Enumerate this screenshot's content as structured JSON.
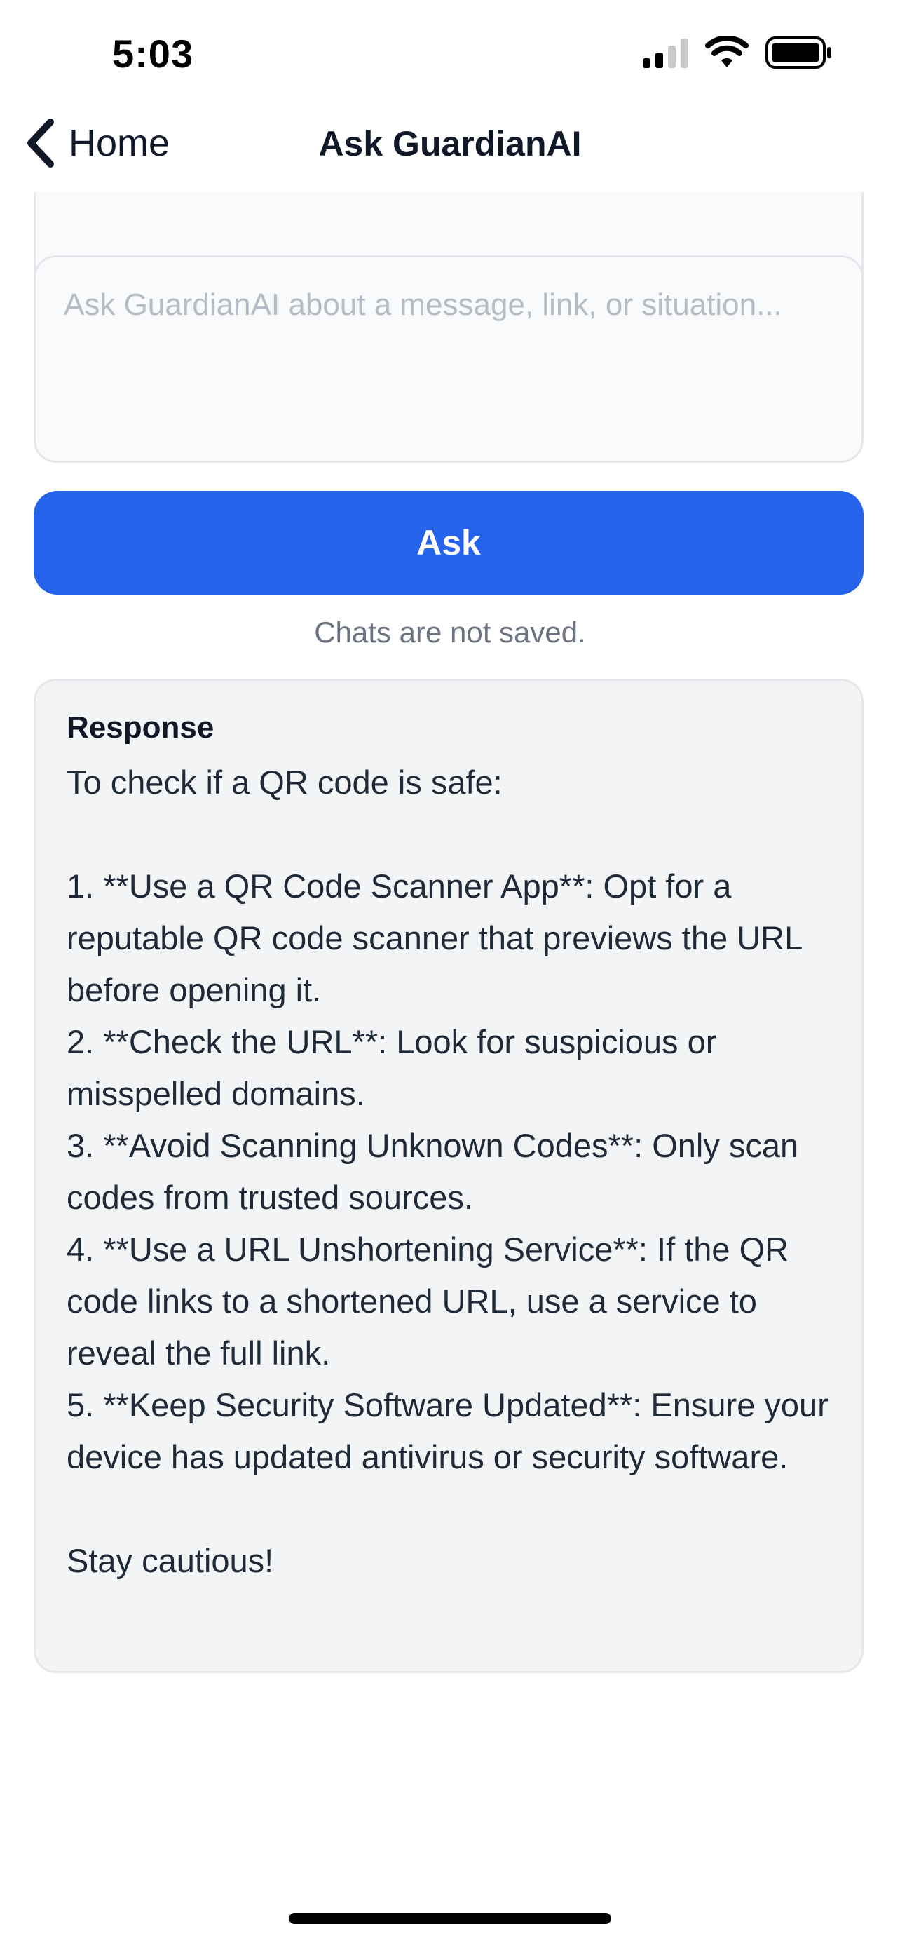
{
  "status_bar": {
    "time": "5:03"
  },
  "nav": {
    "back_label": "Home",
    "title": "Ask GuardianAI"
  },
  "input": {
    "placeholder": "Ask GuardianAI about a message, link, or situation...",
    "value": ""
  },
  "ask_button": {
    "label": "Ask"
  },
  "note": "Chats are not saved.",
  "response": {
    "heading": "Response",
    "text": "To check if a QR code is safe:\n\n1. **Use a QR Code Scanner App**: Opt for a reputable QR code scanner that previews the URL before opening it.\n2. **Check the URL**: Look for suspicious or misspelled domains.\n3. **Avoid Scanning Unknown Codes**: Only scan codes from trusted sources.\n4. **Use a URL Unshortening Service**: If the QR code links to a shortened URL, use a service to reveal the full link.\n5. **Keep Security Software Updated**: Ensure your device has updated antivirus or security software.\n\nStay cautious!"
  },
  "colors": {
    "accent": "#2563eb",
    "card_background": "#f3f4f6",
    "muted_text": "#6b7280"
  }
}
